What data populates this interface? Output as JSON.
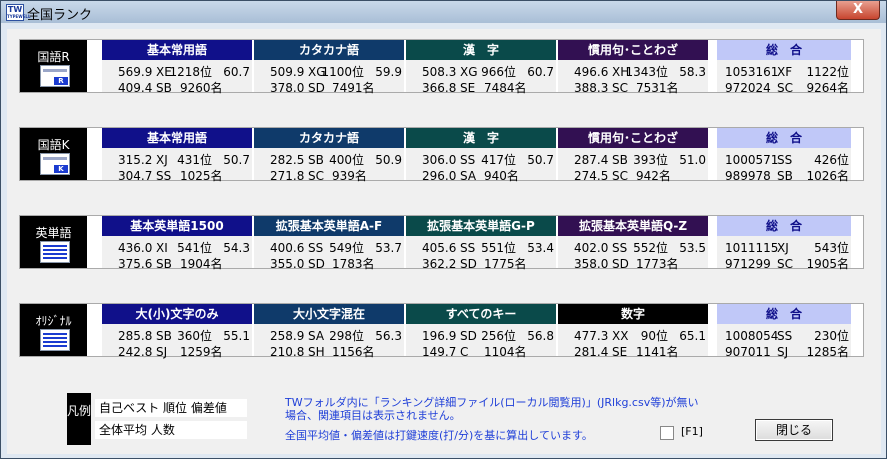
{
  "window": {
    "title": "全国ランク",
    "app_icon": "TW",
    "app_icon_sub": "TYPEWELL",
    "close_glyph": "X"
  },
  "colors": {
    "hdr1": "#10108a",
    "hdr2": "#0f3a6a",
    "hdr3": "#0a4a4a",
    "hdr4": "#321052",
    "total": "#c0c8f8"
  },
  "rows": [
    {
      "label": "国語R",
      "icon": "window-r-icon",
      "icon_letter": "R",
      "cells": [
        {
          "header": "基本常用語",
          "best_time": "569.9",
          "best_rank": "XE",
          "position": "1218位",
          "deviation": "60.7",
          "avg_time": "409.4",
          "avg_rank": "SB",
          "count": "9260名"
        },
        {
          "header": "カタカナ語",
          "best_time": "509.9",
          "best_rank": "XG",
          "position": "1100位",
          "deviation": "59.9",
          "avg_time": "378.0",
          "avg_rank": "SD",
          "count": "7491名"
        },
        {
          "header": "漢　字",
          "best_time": "508.3",
          "best_rank": "XG",
          "position": "966位",
          "deviation": "60.7",
          "avg_time": "366.8",
          "avg_rank": "SE",
          "count": "7484名"
        },
        {
          "header": "慣用句･ことわざ",
          "best_time": "496.6",
          "best_rank": "XH",
          "position": "1343位",
          "deviation": "58.3",
          "avg_time": "388.3",
          "avg_rank": "SC",
          "count": "7531名"
        }
      ],
      "total": {
        "header": "総　合",
        "best_time": "1053161",
        "best_rank": "XF",
        "position": "1122位",
        "avg_time": "972024",
        "avg_rank": "SC",
        "count": "9264名"
      }
    },
    {
      "label": "国語K",
      "icon": "window-k-icon",
      "icon_letter": "K",
      "cells": [
        {
          "header": "基本常用語",
          "best_time": "315.2",
          "best_rank": "XJ",
          "position": "431位",
          "deviation": "50.7",
          "avg_time": "304.7",
          "avg_rank": "SS",
          "count": "1025名"
        },
        {
          "header": "カタカナ語",
          "best_time": "282.5",
          "best_rank": "SB",
          "position": "400位",
          "deviation": "50.9",
          "avg_time": "271.8",
          "avg_rank": "SC",
          "count": "939名"
        },
        {
          "header": "漢　字",
          "best_time": "306.0",
          "best_rank": "SS",
          "position": "417位",
          "deviation": "50.7",
          "avg_time": "296.0",
          "avg_rank": "SA",
          "count": "940名"
        },
        {
          "header": "慣用句･ことわざ",
          "best_time": "287.4",
          "best_rank": "SB",
          "position": "393位",
          "deviation": "51.0",
          "avg_time": "274.5",
          "avg_rank": "SC",
          "count": "942名"
        }
      ],
      "total": {
        "header": "総　合",
        "best_time": "1000571",
        "best_rank": "SS",
        "position": "426位",
        "avg_time": "989978",
        "avg_rank": "SB",
        "count": "1026名"
      }
    },
    {
      "label": "英単語",
      "icon": "list-window-icon",
      "icon_letter": "",
      "cells": [
        {
          "header": "基本英単語1500",
          "best_time": "436.0",
          "best_rank": "XI",
          "position": "541位",
          "deviation": "54.3",
          "avg_time": "375.6",
          "avg_rank": "SB",
          "count": "1904名"
        },
        {
          "header": "拡張基本英単語A-F",
          "best_time": "400.6",
          "best_rank": "SS",
          "position": "549位",
          "deviation": "53.7",
          "avg_time": "355.0",
          "avg_rank": "SD",
          "count": "1783名"
        },
        {
          "header": "拡張基本英単語G-P",
          "best_time": "405.6",
          "best_rank": "SS",
          "position": "551位",
          "deviation": "53.4",
          "avg_time": "362.2",
          "avg_rank": "SD",
          "count": "1775名"
        },
        {
          "header": "拡張基本英単語Q-Z",
          "best_time": "402.0",
          "best_rank": "SS",
          "position": "552位",
          "deviation": "53.5",
          "avg_time": "358.0",
          "avg_rank": "SD",
          "count": "1773名"
        }
      ],
      "total": {
        "header": "総　合",
        "best_time": "1011115",
        "best_rank": "XJ",
        "position": "543位",
        "avg_time": "971299",
        "avg_rank": "SC",
        "count": "1905名"
      }
    },
    {
      "label": "ｵﾘｼﾞﾅﾙ",
      "icon": "list-window-icon",
      "icon_letter": "",
      "cells": [
        {
          "header": "大(小)文字のみ",
          "best_time": "285.8",
          "best_rank": "SB",
          "position": "360位",
          "deviation": "55.1",
          "avg_time": "242.8",
          "avg_rank": "SJ",
          "count": "1259名"
        },
        {
          "header": "大小文字混在",
          "best_time": "258.9",
          "best_rank": "SA",
          "position": "298位",
          "deviation": "56.3",
          "avg_time": "210.8",
          "avg_rank": "SH",
          "count": "1156名"
        },
        {
          "header": "すべてのキー",
          "best_time": "196.9",
          "best_rank": "SD",
          "position": "256位",
          "deviation": "56.8",
          "avg_time": "149.7",
          "avg_rank": "C",
          "count": "1104名"
        },
        {
          "header": "数字",
          "best_time": "477.3",
          "best_rank": "XX",
          "position": "90位",
          "deviation": "65.1",
          "avg_time": "281.4",
          "avg_rank": "SE",
          "count": "1141名"
        }
      ],
      "total": {
        "header": "総　合",
        "best_time": "1008054",
        "best_rank": "SS",
        "position": "230位",
        "avg_time": "907011",
        "avg_rank": "SJ",
        "count": "1285名"
      }
    }
  ],
  "legend": {
    "box": "凡例",
    "line1": "自己ベスト  順位  偏差値",
    "line2": "全体平均    人数"
  },
  "notes": {
    "line1": "TWフォルダ内に「ランキング詳細ファイル(ローカル閲覧用)」(JRlkg.csv等)が無い",
    "line2": "場合、関連項目は表示されません。",
    "line3": "全国平均値・偏差値は打鍵速度(打/分)を基に算出しています。"
  },
  "footer": {
    "f1_label": "[F1]",
    "close_label": "閉じる"
  }
}
